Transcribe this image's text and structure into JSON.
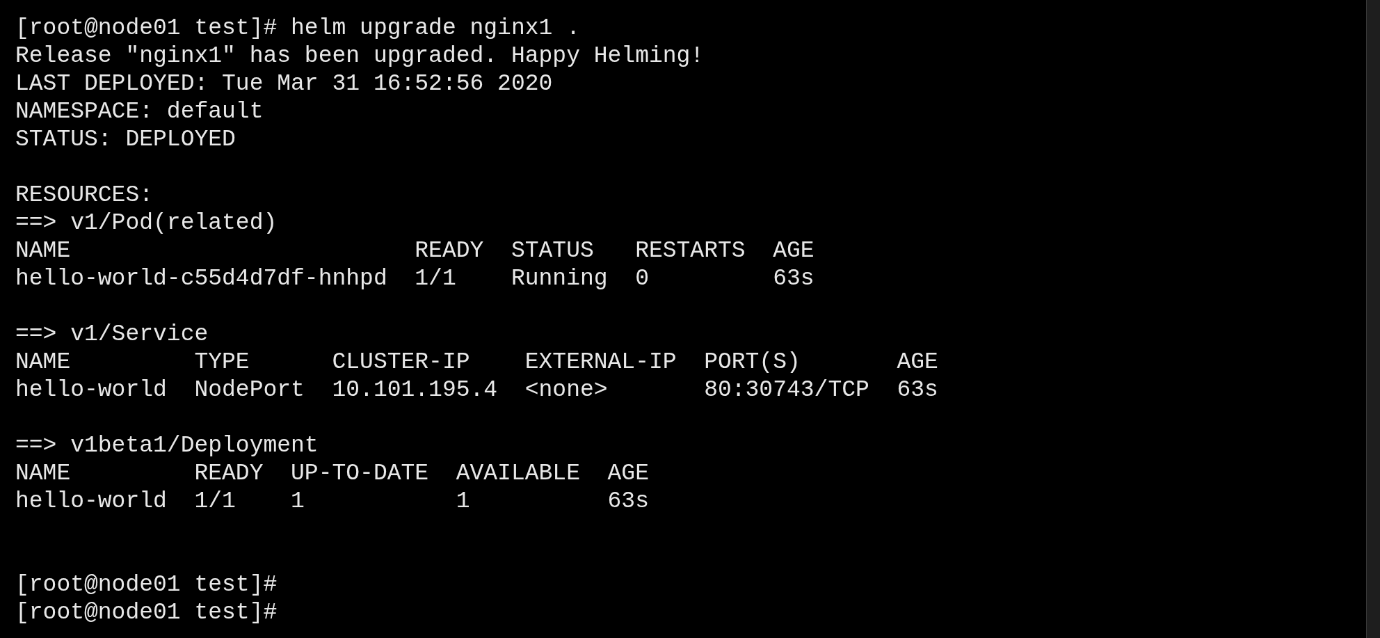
{
  "terminal": {
    "lines": [
      {
        "kind": "text",
        "text": "[root@node01 test]# helm upgrade nginx1 ."
      },
      {
        "kind": "text",
        "text": "Release \"nginx1\" has been upgraded. Happy Helming!"
      },
      {
        "kind": "text",
        "text": "LAST DEPLOYED: Tue Mar 31 16:52:56 2020"
      },
      {
        "kind": "text",
        "text": "NAMESPACE: default"
      },
      {
        "kind": "text",
        "text": "STATUS: DEPLOYED"
      },
      {
        "kind": "blank"
      },
      {
        "kind": "text",
        "text": "RESOURCES:"
      },
      {
        "kind": "text",
        "text": "==> v1/Pod(related)"
      },
      {
        "kind": "text",
        "text": "NAME                         READY  STATUS   RESTARTS  AGE"
      },
      {
        "kind": "text",
        "text": "hello-world-c55d4d7df-hnhpd  1/1    Running  0         63s"
      },
      {
        "kind": "blank"
      },
      {
        "kind": "text",
        "text": "==> v1/Service"
      },
      {
        "kind": "text",
        "text": "NAME         TYPE      CLUSTER-IP    EXTERNAL-IP  PORT(S)       AGE"
      },
      {
        "kind": "text",
        "text": "hello-world  NodePort  10.101.195.4  <none>       80:30743/TCP  63s"
      },
      {
        "kind": "blank"
      },
      {
        "kind": "text",
        "text": "==> v1beta1/Deployment"
      },
      {
        "kind": "text",
        "text": "NAME         READY  UP-TO-DATE  AVAILABLE  AGE"
      },
      {
        "kind": "text",
        "text": "hello-world  1/1    1           1          63s"
      },
      {
        "kind": "blank"
      },
      {
        "kind": "blank"
      },
      {
        "kind": "text",
        "text": "[root@node01 test]#"
      },
      {
        "kind": "text",
        "text": "[root@node01 test]#"
      }
    ]
  }
}
